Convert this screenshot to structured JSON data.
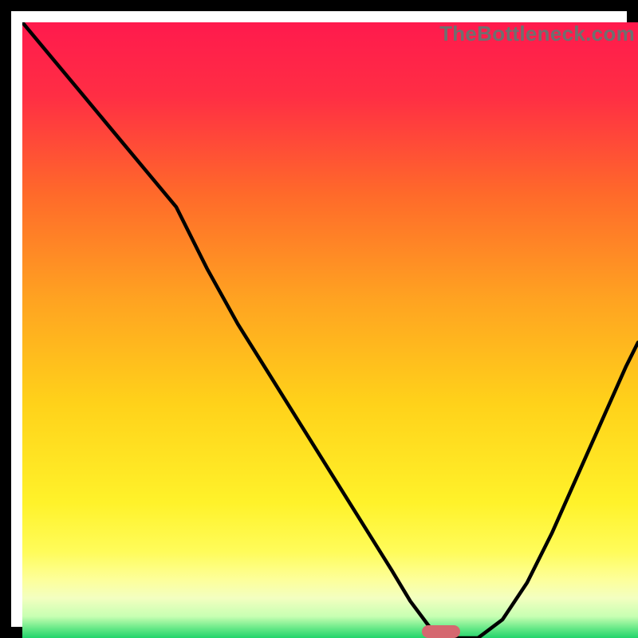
{
  "watermark": "TheBottleneck.com",
  "colors": {
    "frame": "#000000",
    "curve": "#000000",
    "marker": "#d5676f",
    "gradient_stops": [
      {
        "offset": 0.0,
        "color": "#ff1a4d"
      },
      {
        "offset": 0.12,
        "color": "#ff2e44"
      },
      {
        "offset": 0.28,
        "color": "#ff6a2a"
      },
      {
        "offset": 0.45,
        "color": "#ffa321"
      },
      {
        "offset": 0.62,
        "color": "#ffd21a"
      },
      {
        "offset": 0.78,
        "color": "#fff22a"
      },
      {
        "offset": 0.86,
        "color": "#fffc5a"
      },
      {
        "offset": 0.905,
        "color": "#fdff9a"
      },
      {
        "offset": 0.935,
        "color": "#f3ffc0"
      },
      {
        "offset": 0.965,
        "color": "#c7ffb2"
      },
      {
        "offset": 0.985,
        "color": "#63e886"
      },
      {
        "offset": 1.0,
        "color": "#22d36b"
      }
    ]
  },
  "marker": {
    "x_frac": 0.68,
    "width_frac": 0.062
  },
  "chart_data": {
    "type": "line",
    "title": "",
    "xlabel": "",
    "ylabel": "",
    "xlim": [
      0,
      100
    ],
    "ylim": [
      0,
      100
    ],
    "x": [
      0,
      5,
      10,
      15,
      20,
      25,
      30,
      35,
      40,
      45,
      50,
      55,
      60,
      63,
      66,
      68,
      71,
      74,
      78,
      82,
      86,
      90,
      94,
      98,
      100
    ],
    "values": [
      100,
      94,
      88,
      82,
      76,
      70,
      60,
      51,
      43,
      35,
      27,
      19,
      11,
      6,
      2,
      0,
      0,
      0,
      3,
      9,
      17,
      26,
      35,
      44,
      48
    ],
    "annotations": [
      {
        "text": "TheBottleneck.com",
        "pos": "top-right"
      }
    ],
    "optimum_x": 70
  }
}
